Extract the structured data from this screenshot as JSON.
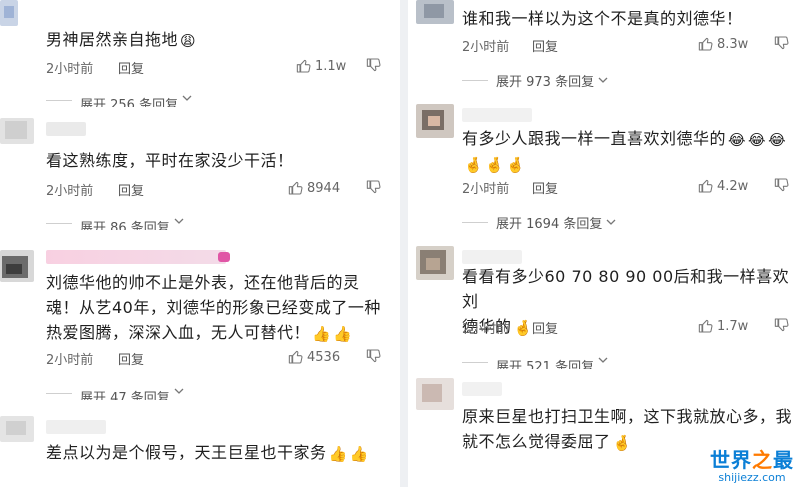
{
  "left": {
    "comments": [
      {
        "text": "男神居然亲自拖地",
        "emojis": [
          "😩"
        ],
        "time": "2小时前",
        "reply": "回复",
        "likes": "1.1w",
        "expand": "展开 256 条回复"
      },
      {
        "text": "看这熟练度，平时在家没少干活！",
        "emojis": [],
        "time": "2小时前",
        "reply": "回复",
        "likes": "8944",
        "expand": "展开 86 条回复"
      },
      {
        "text_lines": [
          "刘德华他的帅不止是外表，还在他背后的灵",
          "魂！从艺40年，刘德华的形象已经变成了一种",
          "热爱图腾，深深入血，无人可替代！"
        ],
        "emojis": [
          "👍",
          "👍"
        ],
        "time": "2小时前",
        "reply": "回复",
        "likes": "4536",
        "expand": "展开 47 条回复"
      },
      {
        "text": "差点以为是个假号，天王巨星也干家务",
        "emojis": [
          "👍",
          "👍"
        ],
        "time": "",
        "reply": "",
        "likes": "",
        "expand": ""
      }
    ]
  },
  "right": {
    "comments": [
      {
        "text": "谁和我一样以为这个不是真的刘德华！",
        "emojis": [],
        "time": "2小时前",
        "reply": "回复",
        "likes": "8.3w",
        "expand": "展开 973 条回复"
      },
      {
        "text": "有多少人跟我一样一直喜欢刘德华的",
        "emojis": [
          "😂",
          "😂",
          "😂",
          "🤞",
          "🤞",
          "🤞"
        ],
        "time": "2小时前",
        "reply": "回复",
        "likes": "4.2w",
        "expand": "展开 1694 条回复"
      },
      {
        "text_lines": [
          "看看有多少60 70 80 90 00后和我一样喜欢刘",
          "德华的"
        ],
        "emojis": [
          "🤞"
        ],
        "time": "2小时前",
        "reply": "回复",
        "likes": "1.7w",
        "expand": "展开 521 条回复"
      },
      {
        "text_lines": [
          "原来巨星也打扫卫生啊，这下我就放心多，我",
          "就不怎么觉得委屈了"
        ],
        "emojis": [
          "🤞"
        ],
        "time": "",
        "reply": "",
        "likes": "",
        "expand": ""
      }
    ]
  },
  "icons": {
    "like": "thumbs-up-icon",
    "dislike": "thumbs-down-icon",
    "expand": "chevron-down-icon"
  },
  "watermark": {
    "main_a": "世界",
    "main_b": "之",
    "main_c": "最",
    "sub": "shijiezz.com"
  },
  "colors": {
    "text": "#1f1f1f",
    "meta": "#666666",
    "accent": "#0b7fd6",
    "watermark_orange": "#ff7a00"
  }
}
